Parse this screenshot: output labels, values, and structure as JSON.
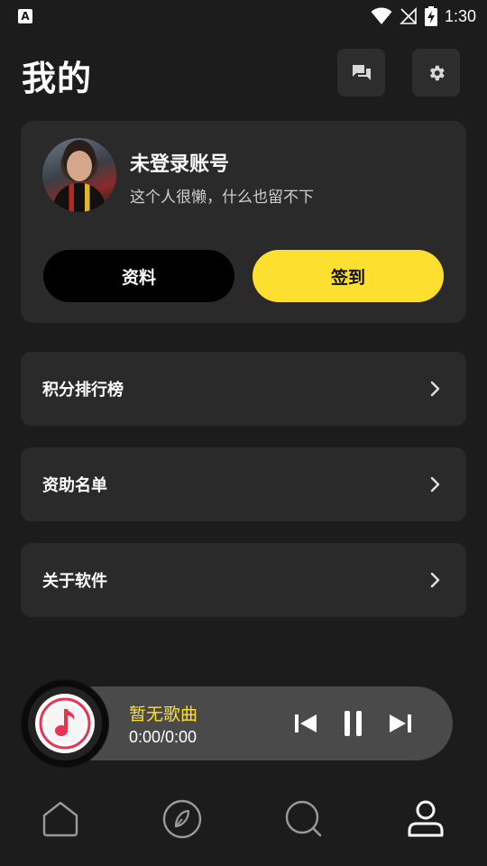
{
  "status_bar": {
    "app_icon_letter": "A",
    "time": "1:30"
  },
  "header": {
    "title": "我的"
  },
  "profile": {
    "name": "未登录账号",
    "bio": "这个人很懒，什么也留不下",
    "profile_button": "资料",
    "checkin_button": "签到"
  },
  "menu": {
    "items": [
      {
        "label": "积分排行榜"
      },
      {
        "label": "资助名单"
      },
      {
        "label": "关于软件"
      }
    ]
  },
  "player": {
    "song_title": "暂无歌曲",
    "time": "0:00/0:00"
  },
  "tabs": {
    "active": "me"
  },
  "colors": {
    "accent": "#fde02f",
    "background": "#1c1c1c",
    "card": "#2a2a2a"
  }
}
